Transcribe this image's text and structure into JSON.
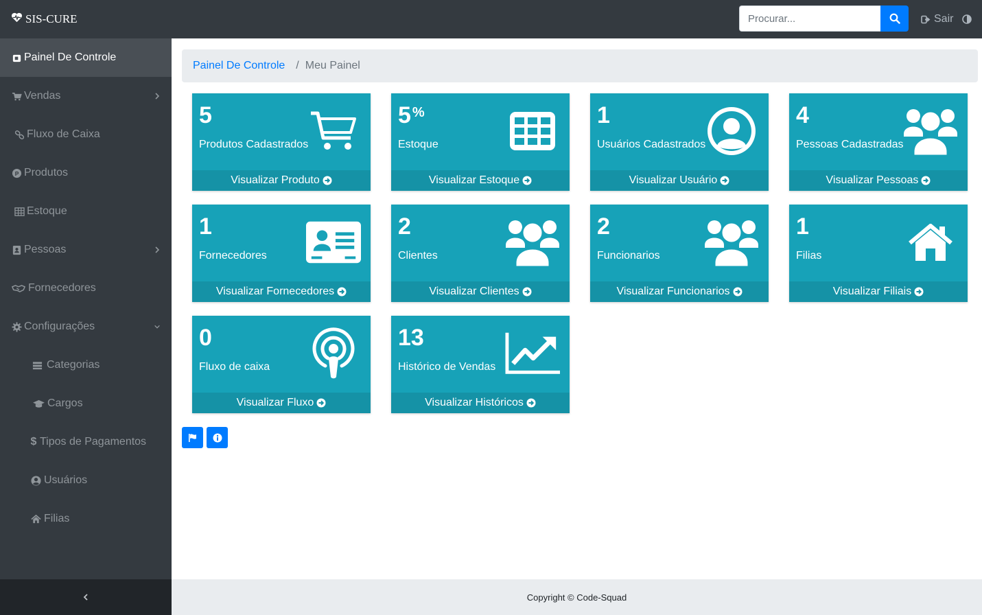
{
  "brand": {
    "name": "SIS-CURE",
    "icon": "heartbeat-icon"
  },
  "search": {
    "placeholder": "Procurar...",
    "value": ""
  },
  "header": {
    "logout_label": "Sair"
  },
  "sidebar": {
    "items": [
      {
        "label": "Painel De Controle",
        "icon": "tachometer-icon",
        "active": true
      },
      {
        "label": "Vendas",
        "icon": "cart-icon",
        "expandable": true
      },
      {
        "label": "Fluxo de Caixa",
        "icon": "link-icon"
      },
      {
        "label": "Produtos",
        "icon": "product-hunt-icon"
      },
      {
        "label": "Estoque",
        "icon": "table-icon"
      },
      {
        "label": "Pessoas",
        "icon": "address-book-icon",
        "expandable": true
      },
      {
        "label": "Fornecedores",
        "icon": "handshake-icon"
      },
      {
        "label": "Configurações",
        "icon": "gear-icon",
        "expanded": true
      },
      {
        "label": "Categorias",
        "icon": "list-icon"
      },
      {
        "label": "Cargos",
        "icon": "graduation-cap-icon"
      },
      {
        "label": "Tipos de Pagamentos",
        "icon": "dollar-icon"
      },
      {
        "label": "Usuários",
        "icon": "user-circle-icon"
      },
      {
        "label": "Filias",
        "icon": "home-icon"
      }
    ]
  },
  "breadcrumb": {
    "parent": "Painel De Controle",
    "separator": "/",
    "current": "Meu Painel"
  },
  "cards": [
    {
      "value": "5",
      "label": "Produtos Cadastrados",
      "link": "Visualizar Produto",
      "icon": "shopping-cart-icon"
    },
    {
      "value": "5",
      "suffix": "%",
      "label": "Estoque",
      "link": "Visualizar Estoque",
      "icon": "table-grid-icon"
    },
    {
      "value": "1",
      "label": "Usuários Cadastrados",
      "link": "Visualizar Usuário",
      "icon": "user-circle-icon"
    },
    {
      "value": "4",
      "label": "Pessoas Cadastradas",
      "link": "Visualizar Pessoas",
      "icon": "users-icon"
    },
    {
      "value": "1",
      "label": "Fornecedores",
      "link": "Visualizar Fornecedores",
      "icon": "id-card-icon"
    },
    {
      "value": "2",
      "label": "Clientes",
      "link": "Visualizar Clientes",
      "icon": "users-icon"
    },
    {
      "value": "2",
      "label": "Funcionarios",
      "link": "Visualizar Funcionarios",
      "icon": "users-icon"
    },
    {
      "value": "1",
      "label": "Filias",
      "link": "Visualizar Filiais",
      "icon": "home-icon"
    },
    {
      "value": "0",
      "label": "Fluxo de caixa",
      "link": "Visualizar Fluxo",
      "icon": "podcast-icon"
    },
    {
      "value": "13",
      "label": "Histórico de Vendas",
      "link": "Visualizar Históricos",
      "icon": "line-chart-icon"
    }
  ],
  "footer": {
    "copyright": "Copyright © Code-Squad"
  },
  "colors": {
    "topbar": "#343a40",
    "sidebar": "#343a40",
    "card": "#17a2b8",
    "card_footer": "#1592a6",
    "primary": "#007bff",
    "breadcrumb_bg": "#e9ecef"
  }
}
